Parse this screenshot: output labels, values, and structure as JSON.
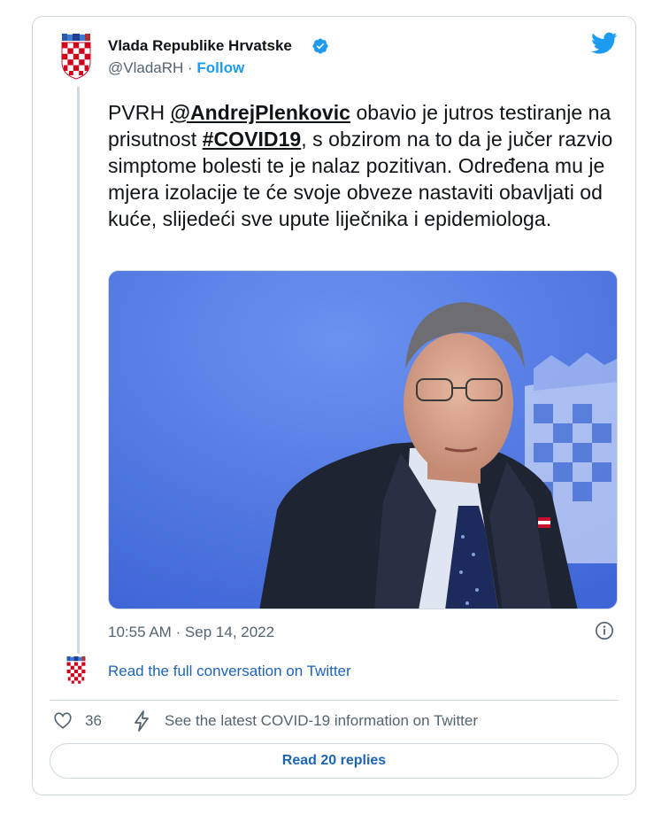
{
  "author": {
    "name": "Vlada Republike Hrvatske",
    "handle": "@VladaRH",
    "separator": " · ",
    "follow_label": "Follow",
    "verified_icon": "verified-badge-icon",
    "avatar_icon": "croatian-coat-of-arms-icon"
  },
  "brand": {
    "icon": "twitter-bird-icon",
    "color": "#1d9bf0"
  },
  "tweet": {
    "prefix": "PVRH ",
    "mention": "@AndrejPlenkovic",
    "text_mid": " obavio je jutros testiranje na prisutnost ",
    "hashtag": "#COVID19",
    "text_end": ", s obzirom na to da je jučer razvio simptome bolesti te je nalaz pozitivan. Određena mu je mjera izolacije te će svoje obveze nastaviti obavljati od kuće, slijedeći sve upute liječnika i epidemiologa."
  },
  "media": {
    "description_icon": "photo-of-speaker-icon",
    "background_color": "#4d77e3"
  },
  "timestamp": "10:55 AM · Sep 14, 2022",
  "conversation": {
    "link_label": "Read the full conversation on Twitter"
  },
  "actions": {
    "like_count": "36",
    "covid_info_label": "See the latest COVID-19 information on Twitter",
    "read_replies_label": "Read 20 replies"
  },
  "colors": {
    "link": "#1d63b8",
    "muted": "#536471",
    "border": "#cfd9de",
    "text": "#0f1419"
  }
}
